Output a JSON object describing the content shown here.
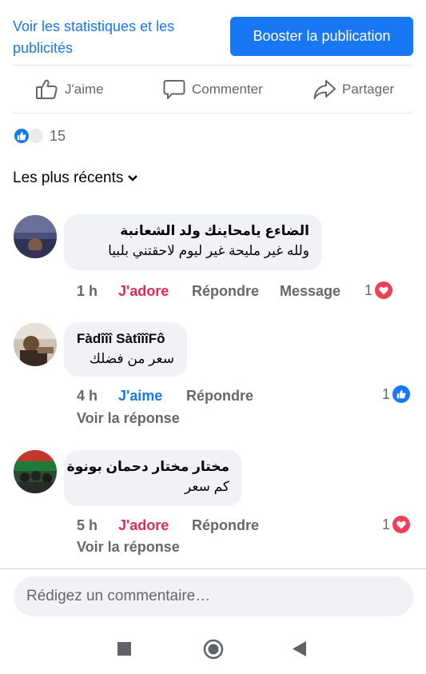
{
  "header": {
    "stats_link": "Voir les statistiques et les publicités",
    "boost_button": "Booster la publication"
  },
  "actions": {
    "like": "J'aime",
    "comment": "Commenter",
    "share": "Partager"
  },
  "reactions": {
    "count": "15"
  },
  "sort": {
    "label": "Les plus récents"
  },
  "comments": [
    {
      "author": "الضاءع يامحاينك ولد الشعانبة",
      "text": "ولله غير مليحة غير ليوم لاحقتني بلبيا",
      "time": "1 h",
      "reaction_action": "J'adore",
      "reply": "Répondre",
      "message": "Message",
      "reaction_count": "1",
      "reaction_type": "love"
    },
    {
      "author": "Fàdîîî SàtîîîFô",
      "text": "سعر من فضلك",
      "time": "4 h",
      "reaction_action": "J'aime",
      "reply": "Répondre",
      "reaction_count": "1",
      "reaction_type": "like",
      "view_reply": "Voir la réponse"
    },
    {
      "author": "مختار مختار دحمان بونوة",
      "text": "كم سعر",
      "time": "5 h",
      "reaction_action": "J'adore",
      "reply": "Répondre",
      "reaction_count": "1",
      "reaction_type": "love",
      "view_reply": "Voir la réponse"
    }
  ],
  "composer": {
    "placeholder": "Rédigez un commentaire…"
  },
  "colors": {
    "accent": "#1877f2",
    "love": "#e4285d",
    "secondary_text": "#65676b",
    "bubble": "#f0f2f5"
  },
  "icons": [
    "thumbs-up-icon",
    "comment-icon",
    "share-icon",
    "like-reaction-icon",
    "love-reaction-icon",
    "chevron-down-icon",
    "nav-recent-icon",
    "nav-home-icon",
    "nav-back-icon"
  ]
}
